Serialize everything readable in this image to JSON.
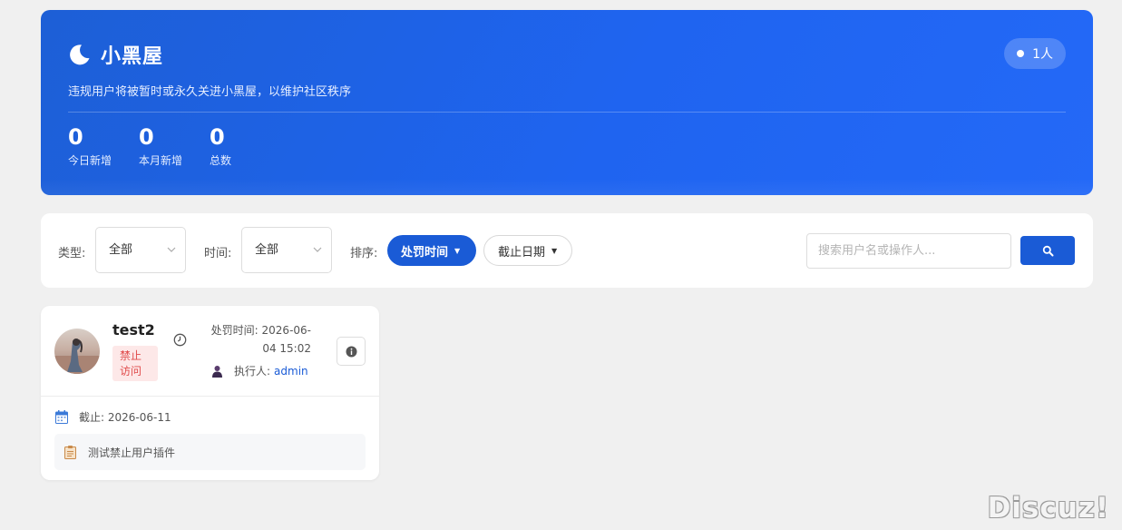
{
  "header": {
    "title": "小黑屋",
    "description": "违规用户将被暂时或永久关进小黑屋，以维护社区秩序",
    "count_badge": "1人",
    "stats": [
      {
        "value": "0",
        "label": "今日新增"
      },
      {
        "value": "0",
        "label": "本月新增"
      },
      {
        "value": "0",
        "label": "总数"
      }
    ]
  },
  "filters": {
    "type_label": "类型:",
    "type_value": "全部",
    "time_label": "时间:",
    "time_value": "全部",
    "sort_label": "排序:",
    "sort_active": "处罚时间",
    "sort_inactive": "截止日期",
    "search_placeholder": "搜索用户名或操作人..."
  },
  "card": {
    "username": "test2",
    "badge": "禁止访问",
    "punish_time_line1": "处罚时间: 2026-06-",
    "punish_time_line2": "04 15:02",
    "executor_label": "执行人:",
    "executor_name": "admin",
    "until": "截止: 2026-06-11",
    "reason": "测试禁止用户插件"
  },
  "watermark": "Discuz!",
  "colors": {
    "primary": "#1a5bd6",
    "banner": "#1f64f0",
    "badge_bg": "#fde8e8",
    "badge_text": "#e04b4b"
  },
  "icons": [
    "moon-icon",
    "chevron-down-icon",
    "search-icon",
    "clock-icon",
    "user-icon",
    "info-icon",
    "calendar-icon",
    "document-icon"
  ]
}
